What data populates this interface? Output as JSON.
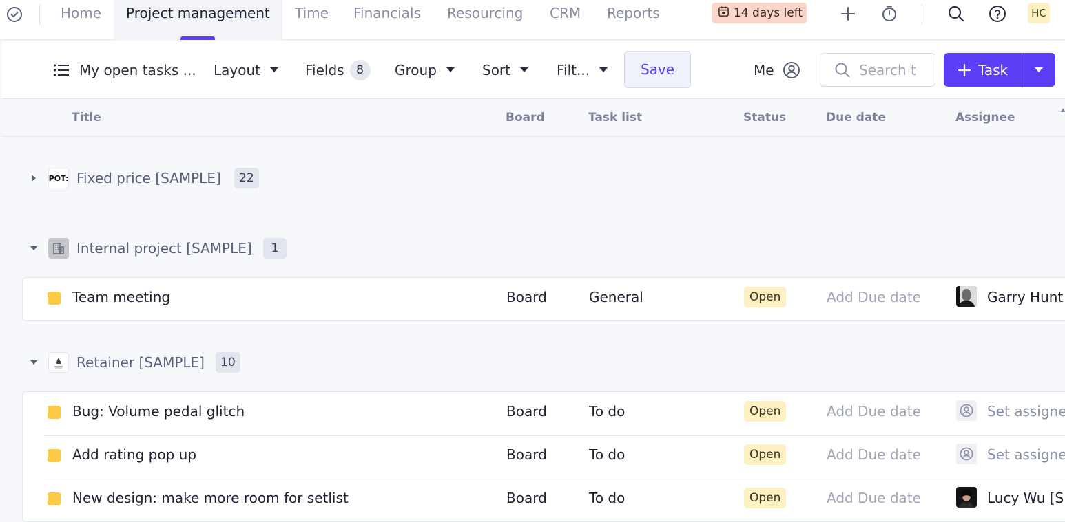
{
  "nav": {
    "tabs": [
      {
        "label": "Home"
      },
      {
        "label": "Project management"
      },
      {
        "label": "Time"
      },
      {
        "label": "Financials"
      },
      {
        "label": "Resourcing"
      },
      {
        "label": "CRM"
      },
      {
        "label": "Reports"
      }
    ],
    "trial_badge": "14 days left",
    "user_initials": "HC"
  },
  "toolbar": {
    "view_name": "My open tasks ...",
    "layout_label": "Layout",
    "fields_label": "Fields",
    "fields_count": "8",
    "group_label": "Group",
    "sort_label": "Sort",
    "filter_label": "Filt...",
    "save_label": "Save",
    "me_label": "Me",
    "search_placeholder": "Search t",
    "task_button_label": "Task"
  },
  "columns": {
    "title": "Title",
    "board": "Board",
    "task_list": "Task list",
    "status": "Status",
    "due_date": "Due date",
    "assignee": "Assignee"
  },
  "groups": [
    {
      "title": "Fixed price [SAMPLE]",
      "count": "22",
      "logo_text": "POT:",
      "expanded": false,
      "tasks": []
    },
    {
      "title": "Internal project [SAMPLE]",
      "count": "1",
      "expanded": true,
      "tasks": [
        {
          "title": "Team meeting",
          "board": "Board",
          "task_list": "General",
          "status": "Open",
          "due": "Add Due date",
          "assignee": "Garry Hunt"
        }
      ]
    },
    {
      "title": "Retainer [SAMPLE]",
      "count": "10",
      "expanded": true,
      "tasks": [
        {
          "title": "Bug: Volume pedal glitch",
          "board": "Board",
          "task_list": "To do",
          "status": "Open",
          "due": "Add Due date",
          "assignee": "Set assignee"
        },
        {
          "title": "Add rating pop up",
          "board": "Board",
          "task_list": "To do",
          "status": "Open",
          "due": "Add Due date",
          "assignee": "Set assignee"
        },
        {
          "title": "New design: make more room for setlist",
          "board": "Board",
          "task_list": "To do",
          "status": "Open",
          "due": "Add Due date",
          "assignee": "Lucy Wu [S"
        }
      ]
    }
  ],
  "colors": {
    "accent": "#5b3df5",
    "status_open_bg": "#fdf0c2",
    "task_marker": "#fcca46",
    "trial_bg": "#fbd5c9"
  }
}
